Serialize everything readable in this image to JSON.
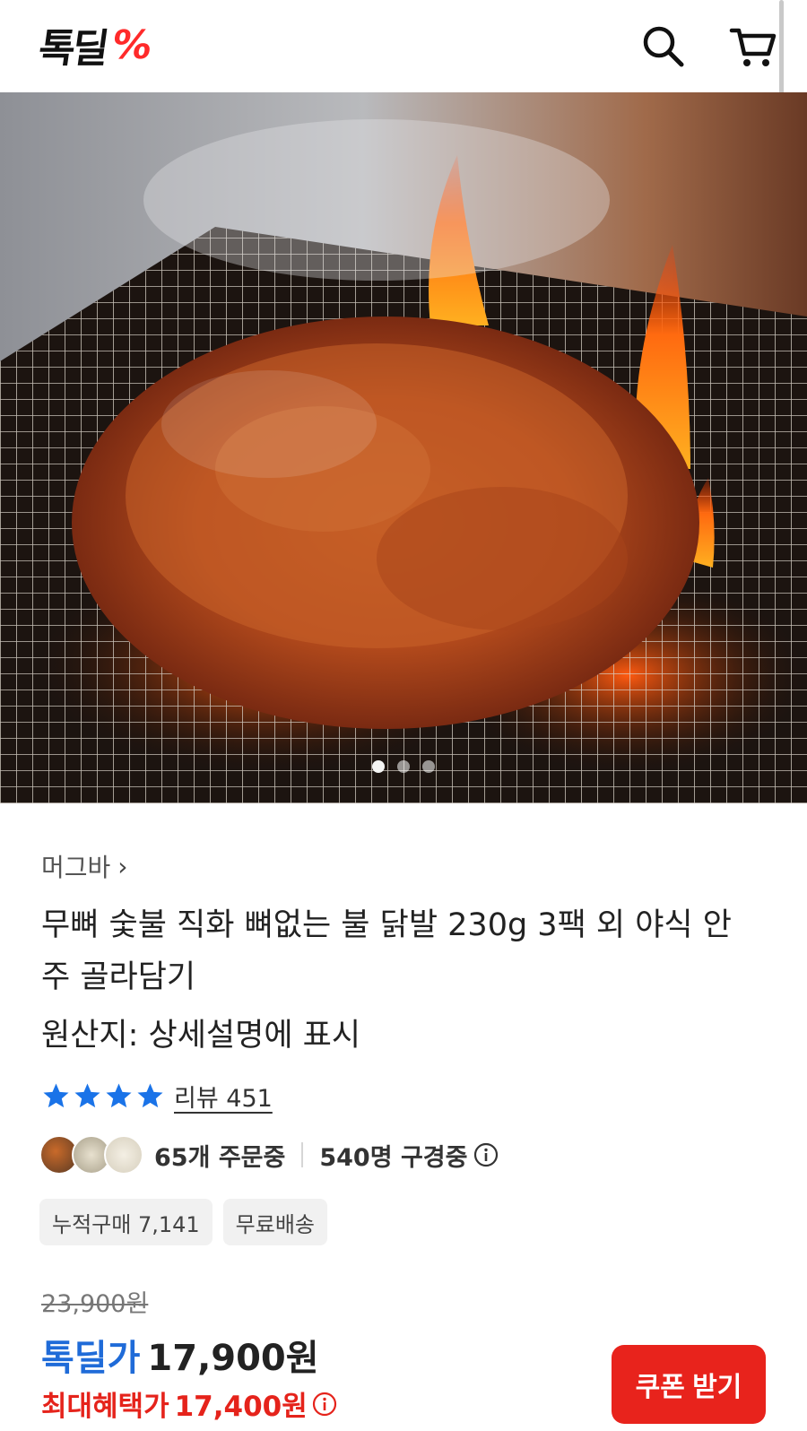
{
  "header": {
    "logo_text": "톡딜",
    "logo_mark": "%",
    "search_icon": "search-icon",
    "cart_icon": "cart-icon"
  },
  "gallery": {
    "image_description": "grilled spicy chicken feet on charcoal grill with flames",
    "dot_count": 3,
    "active_index": 0
  },
  "product": {
    "seller": "머그바",
    "seller_chevron": "›",
    "title": "무뼈 숯불 직화 뼈없는 불 닭발 230g 3팩 외 야식 안주 골라담기",
    "origin": "원산지: 상세설명에 표시",
    "rating_stars": 4,
    "review_link": "리뷰 451",
    "orders": "65개 주문중",
    "viewers": "540명 구경중",
    "tags": [
      "누적구매 7,141",
      "무료배송"
    ],
    "original_price": "23,900원",
    "deal_label": "톡딜가",
    "deal_price": "17,900원",
    "max_benefit_label": "최대혜택가",
    "max_benefit_price": "17,400원",
    "coupon_button": "쿠폰 받기"
  },
  "colors": {
    "brand_red": "#e8231c",
    "deal_blue": "#1f6bd8",
    "star_blue": "#1a73e8"
  }
}
